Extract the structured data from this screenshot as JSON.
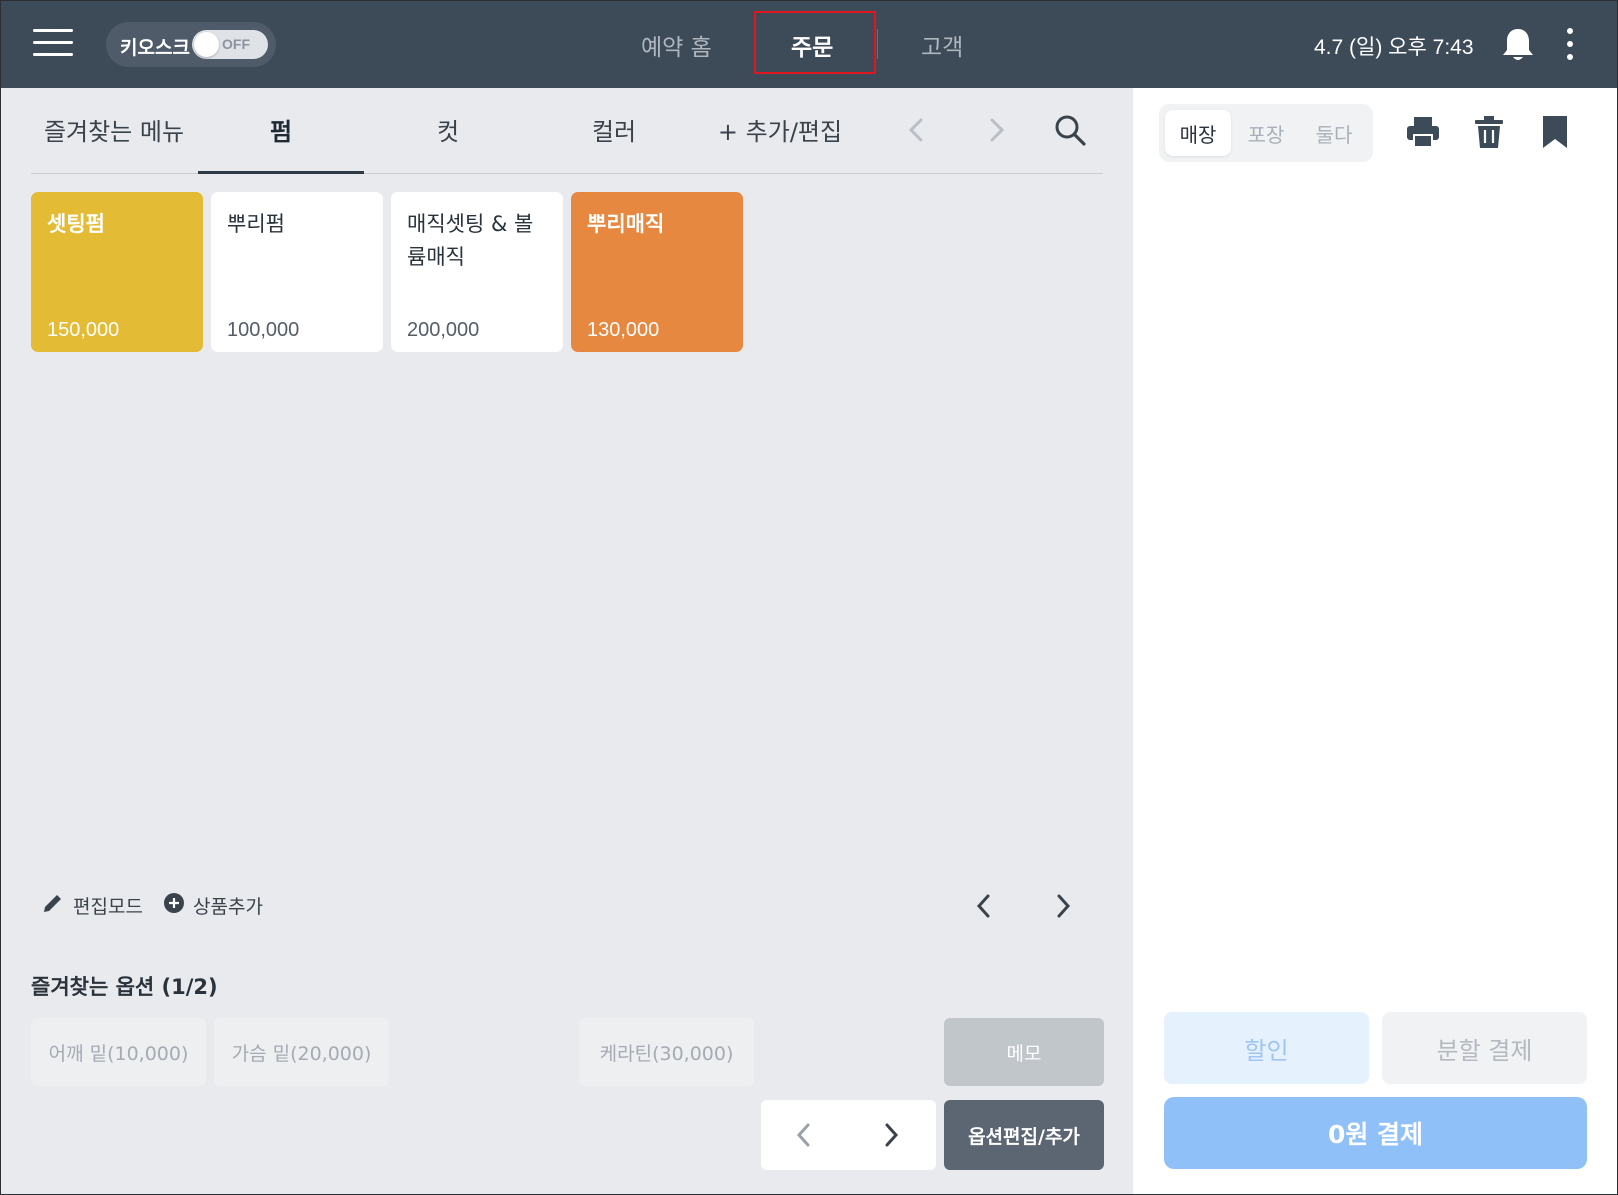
{
  "topbar": {
    "kiosk_label": "키오스크",
    "kiosk_state": "OFF",
    "nav": [
      "예약 홈",
      "주문",
      "고객"
    ],
    "active_nav": "주문",
    "datetime": "4.7 (일) 오후 7:43",
    "highlight_color": "#e0161f"
  },
  "categories": {
    "tabs": [
      "즐겨찾는 메뉴",
      "펌",
      "컷",
      "컬러",
      "+ 추가/편집"
    ],
    "active": "펌"
  },
  "menu_items": [
    {
      "name": "셋팅펌",
      "price": "150,000",
      "color": "#e4bb34"
    },
    {
      "name": "뿌리펌",
      "price": "100,000",
      "color": "#ffffff"
    },
    {
      "name": "매직셋팅 & 볼륨매직",
      "price": "200,000",
      "color": "#ffffff"
    },
    {
      "name": "뿌리매직",
      "price": "130,000",
      "color": "#e6883f"
    }
  ],
  "tools": {
    "edit_mode": "편집모드",
    "add_product": "상품추가"
  },
  "favorite_options": {
    "title": "즐겨찾는 옵션 (1/2)",
    "options": [
      "어깨 밑(10,000)",
      "가슴 밑(20,000)",
      "케라틴(30,000)"
    ],
    "memo": "메모",
    "edit_add": "옵션편집/추가"
  },
  "order": {
    "segments": [
      "매장",
      "포장",
      "둘다"
    ],
    "active_segment": "매장",
    "discount": "할인",
    "split_pay": "분할 결제",
    "pay": "0원 결제"
  }
}
